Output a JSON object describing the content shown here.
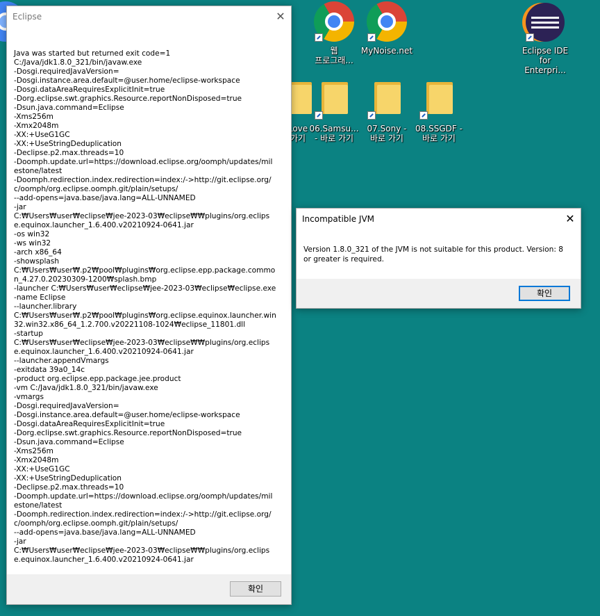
{
  "desktop": {
    "icons": [
      {
        "label": "웹\n프로그래...",
        "icon": "chrome-icon"
      },
      {
        "label": "MyNoise.net",
        "icon": "chrome-icon"
      },
      {
        "label": "Eclipse IDE\nfor Enterpri...",
        "icon": "eclipse-icon"
      },
      {
        "label": "Love\n가기",
        "icon": "folder-icon"
      },
      {
        "label": "06.Samsu...\n- 바로 가기",
        "icon": "folder-icon"
      },
      {
        "label": "07.Sony -\n바로 가기",
        "icon": "folder-icon"
      },
      {
        "label": "08.SSGDF -\n바로 가기",
        "icon": "folder-icon"
      }
    ]
  },
  "eclipse_window": {
    "title": "Eclipse",
    "lines": [
      "Java was started but returned exit code=1",
      "C:/Java/jdk1.8.0_321/bin/javaw.exe",
      "-Dosgi.requiredJavaVersion=",
      "-Dosgi.instance.area.default=@user.home/eclipse-workspace",
      "-Dosgi.dataAreaRequiresExplicitInit=true",
      "-Dorg.eclipse.swt.graphics.Resource.reportNonDisposed=true",
      "-Dsun.java.command=Eclipse",
      "-Xms256m",
      "-Xmx2048m",
      "-XX:+UseG1GC",
      "-XX:+UseStringDeduplication",
      "-Declipse.p2.max.threads=10",
      "-Doomph.update.url=https://download.eclipse.org/oomph/updates/milestone/latest",
      "-Doomph.redirection.index.redirection=index:/->http://git.eclipse.org/c/oomph/org.eclipse.oomph.git/plain/setups/",
      "--add-opens=java.base/java.lang=ALL-UNNAMED",
      "-jar",
      "C:₩Users₩user₩eclipse₩jee-2023-03₩eclipse₩₩plugins/org.eclipse.equinox.launcher_1.6.400.v20210924-0641.jar",
      "-os win32",
      "-ws win32",
      "-arch x86_64",
      "-showsplash",
      "C:₩Users₩user₩.p2₩pool₩plugins₩org.eclipse.epp.package.common_4.27.0.20230309-1200₩splash.bmp",
      "-launcher C:₩Users₩user₩eclipse₩jee-2023-03₩eclipse₩eclipse.exe",
      "-name Eclipse",
      "--launcher.library",
      "C:₩Users₩user₩.p2₩pool₩plugins₩org.eclipse.equinox.launcher.win32.win32.x86_64_1.2.700.v20221108-1024₩eclipse_11801.dll",
      "-startup",
      "C:₩Users₩user₩eclipse₩jee-2023-03₩eclipse₩₩plugins/org.eclipse.equinox.launcher_1.6.400.v20210924-0641.jar",
      "--launcher.appendVmargs",
      "-exitdata 39a0_14c",
      "-product org.eclipse.epp.package.jee.product",
      "-vm C:/Java/jdk1.8.0_321/bin/javaw.exe",
      "-vmargs",
      "-Dosgi.requiredJavaVersion=",
      "-Dosgi.instance.area.default=@user.home/eclipse-workspace",
      "-Dosgi.dataAreaRequiresExplicitInit=true",
      "-Dorg.eclipse.swt.graphics.Resource.reportNonDisposed=true",
      "-Dsun.java.command=Eclipse",
      "-Xms256m",
      "-Xmx2048m",
      "-XX:+UseG1GC",
      "-XX:+UseStringDeduplication",
      "-Declipse.p2.max.threads=10",
      "-Doomph.update.url=https://download.eclipse.org/oomph/updates/milestone/latest",
      "-Doomph.redirection.index.redirection=index:/->http://git.eclipse.org/c/oomph/org.eclipse.oomph.git/plain/setups/",
      "--add-opens=java.base/java.lang=ALL-UNNAMED",
      "-jar",
      "C:₩Users₩user₩eclipse₩jee-2023-03₩eclipse₩₩plugins/org.eclipse.equinox.launcher_1.6.400.v20210924-0641.jar"
    ],
    "ok_label": "확인"
  },
  "jvm_dialog": {
    "title": "Incompatible JVM",
    "message": "Version 1.8.0_321 of the JVM is not suitable for this product. Version: 8 or greater is required.",
    "ok_label": "확인"
  }
}
